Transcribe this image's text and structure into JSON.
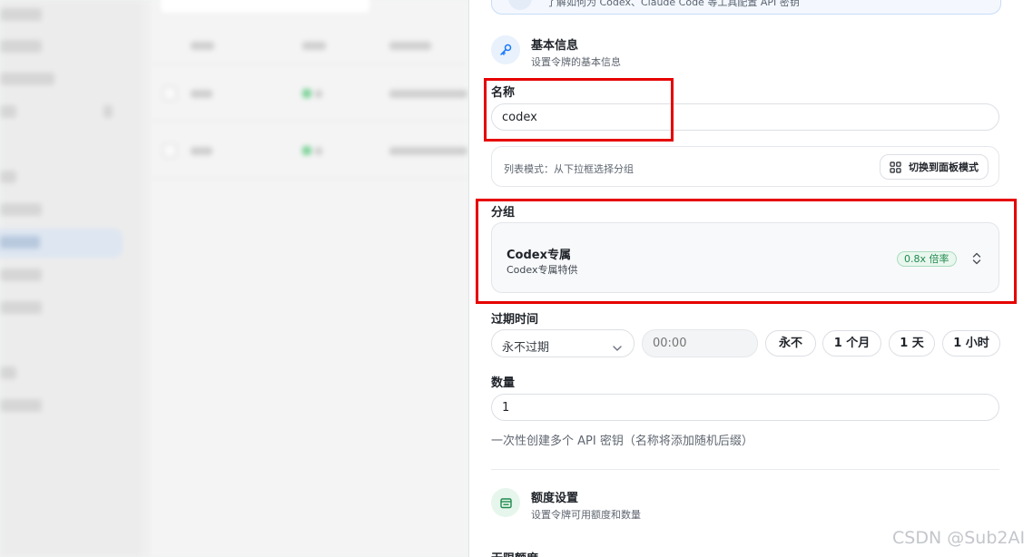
{
  "background": {
    "note_hidden": ""
  },
  "info_banner": {
    "text": "了解如何为 Codex、Claude Code 等工具配置 API 密钥"
  },
  "basic_info": {
    "title": "基本信息",
    "subtitle": "设置令牌的基本信息",
    "icon": "key-icon"
  },
  "name_field": {
    "label": "名称",
    "value": "codex"
  },
  "group_mode": {
    "text": "列表模式：从下拉框选择分组",
    "switch_label": "切换到面板模式",
    "icon": "grid-icon"
  },
  "group_field": {
    "label": "分组",
    "selected_name": "Codex专属",
    "selected_desc": "Codex专属特供",
    "rate_badge": "0.8x 倍率",
    "badge_color": "#1f8a4c"
  },
  "expiry_field": {
    "label": "过期时间",
    "select_value": "永不过期",
    "time_placeholder": "00:00",
    "quick_options": [
      "永不",
      "1 个月",
      "1 天",
      "1 小时"
    ]
  },
  "quantity_field": {
    "label": "数量",
    "value": "1",
    "help": "一次性创建多个 API 密钥（名称将添加随机后缀）"
  },
  "quota_section": {
    "title": "额度设置",
    "subtitle": "设置令牌可用额度和数量",
    "icon": "wallet-icon"
  },
  "next_section_label": "无限额度",
  "watermark": "CSDN @Sub2AI",
  "colors": {
    "accent_blue": "#1677ff",
    "accent_green": "#1f8a4c",
    "highlight_red": "#e60000"
  }
}
